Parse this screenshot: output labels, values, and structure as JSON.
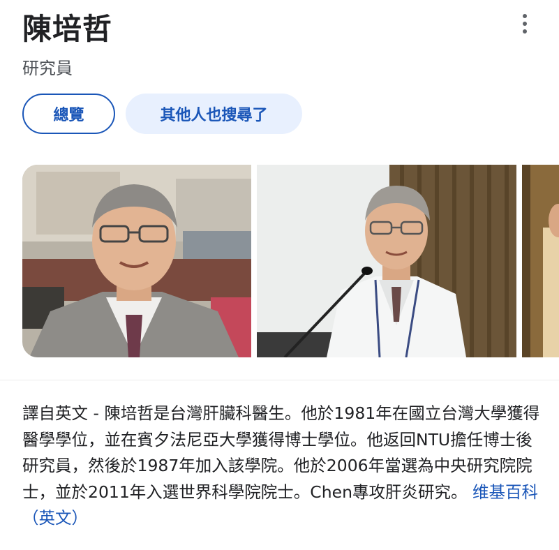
{
  "header": {
    "title": "陳培哲",
    "subtitle": "研究員"
  },
  "tabs": [
    {
      "label": "總覽",
      "active": true
    },
    {
      "label": "其他人也搜尋了",
      "active": false
    }
  ],
  "images": [
    {
      "alt": "陳培哲"
    },
    {
      "alt": "陳培哲"
    },
    {
      "alt": "陳培哲"
    }
  ],
  "description": {
    "text": "譯自英文 - 陳培哲是台灣肝臟科醫生。他於1981年在國立台灣大學獲得醫學學位，並在賓夕法尼亞大學獲得博士學位。他返回NTU擔任博士後研究員，然後於1987年加入該學院。他於2006年當選為中央研究院院士，並於2011年入選世界科學院院士。Chen專攻肝炎研究。",
    "source_link": "维基百科（英文）"
  },
  "colors": {
    "accent": "#1a56b8",
    "chip_bg": "#e8f0fe",
    "text": "#202124",
    "secondary_text": "#4d5156"
  },
  "icons": {
    "more": "more-vert-icon"
  }
}
